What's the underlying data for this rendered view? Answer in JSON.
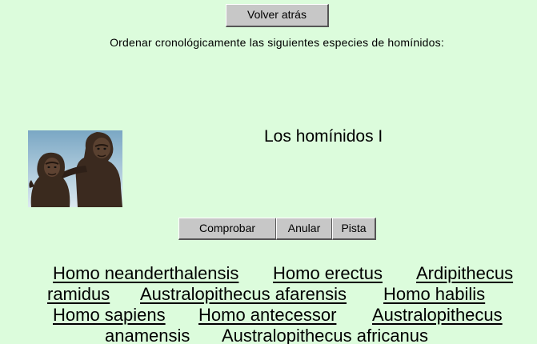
{
  "nav": {
    "back_label": "Volver atrás"
  },
  "instructions": "Ordenar cronológicamente las siguientes especies de homínidos:",
  "title": "Los homínidos I",
  "controls": {
    "check_label": "Comprobar",
    "undo_label": "Anular",
    "hint_label": "Pista"
  },
  "species": [
    "Homo neanderthalensis",
    "Homo erectus",
    "Ardipithecus",
    "ramidus",
    "Australopithecus afarensis",
    "Homo habilis",
    "Homo sapiens",
    "Homo antecessor",
    "Australopithecus",
    "anamensis",
    "Australopithecus africanus"
  ],
  "colors": {
    "background": "#dcfcdc",
    "button": "#c7c7c7"
  },
  "image": {
    "icon": "hominids-photo"
  }
}
